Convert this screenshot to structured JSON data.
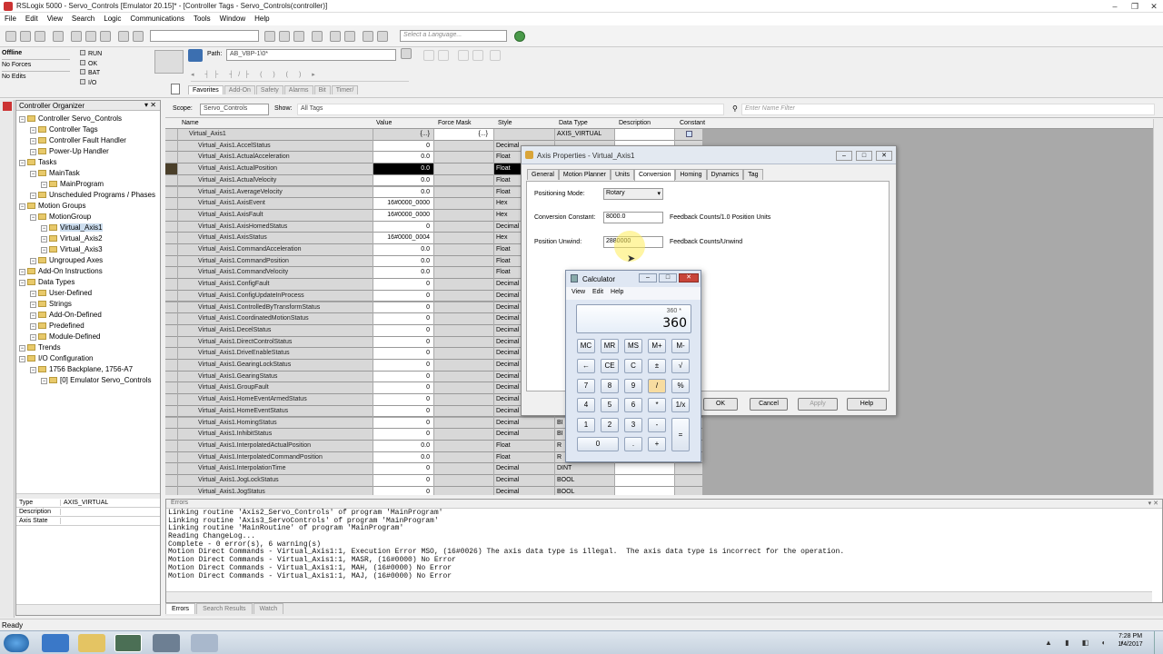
{
  "window": {
    "title": "RSLogix 5000 - Servo_Controls [Emulator 20.15]* - [Controller Tags - Servo_Controls(controller)]"
  },
  "menu": [
    "File",
    "Edit",
    "View",
    "Search",
    "Logic",
    "Communications",
    "Tools",
    "Window",
    "Help"
  ],
  "toolbar": {
    "language_placeholder": "Select a Language..."
  },
  "status": {
    "mode": "Offline",
    "forces": "No Forces",
    "edits": "No Edits",
    "leds": [
      "RUN",
      "OK",
      "BAT",
      "I/O"
    ],
    "path_label": "Path:",
    "path_value": "AB_VBP-1\\0*"
  },
  "instr_tabs": [
    "Favorites",
    "Add-On",
    "Safety",
    "Alarms",
    "Bit",
    "Timer/"
  ],
  "organizer": {
    "title": "Controller Organizer",
    "items": [
      {
        "label": "Controller Servo_Controls",
        "d": 1
      },
      {
        "label": "Controller Tags",
        "d": 2
      },
      {
        "label": "Controller Fault Handler",
        "d": 2
      },
      {
        "label": "Power-Up Handler",
        "d": 2
      },
      {
        "label": "Tasks",
        "d": 1
      },
      {
        "label": "MainTask",
        "d": 2
      },
      {
        "label": "MainProgram",
        "d": 3
      },
      {
        "label": "Unscheduled Programs / Phases",
        "d": 2
      },
      {
        "label": "Motion Groups",
        "d": 1
      },
      {
        "label": "MotionGroup",
        "d": 2
      },
      {
        "label": "Virtual_Axis1",
        "d": 3
      },
      {
        "label": "Virtual_Axis2",
        "d": 3
      },
      {
        "label": "Virtual_Axis3",
        "d": 3
      },
      {
        "label": "Ungrouped Axes",
        "d": 2
      },
      {
        "label": "Add-On Instructions",
        "d": 1
      },
      {
        "label": "Data Types",
        "d": 1
      },
      {
        "label": "User-Defined",
        "d": 2
      },
      {
        "label": "Strings",
        "d": 2
      },
      {
        "label": "Add-On-Defined",
        "d": 2
      },
      {
        "label": "Predefined",
        "d": 2
      },
      {
        "label": "Module-Defined",
        "d": 2
      },
      {
        "label": "Trends",
        "d": 1
      },
      {
        "label": "I/O Configuration",
        "d": 1
      },
      {
        "label": "1756 Backplane, 1756-A7",
        "d": 2
      },
      {
        "label": "[0] Emulator Servo_Controls",
        "d": 3
      }
    ],
    "props": [
      [
        "Type",
        "AXIS_VIRTUAL"
      ],
      [
        "Description",
        ""
      ],
      [
        "Axis State",
        ""
      ]
    ]
  },
  "tags": {
    "scope_label": "Scope:",
    "scope_value": "Servo_Controls",
    "show_label": "Show:",
    "show_value": "All Tags",
    "filter_placeholder": "Enter Name Filter",
    "columns": [
      "Name",
      "Value",
      "Force Mask",
      "Style",
      "Data Type",
      "Description",
      "Constant"
    ],
    "rows": [
      [
        "Virtual_Axis1",
        "{...}",
        "{...}",
        "",
        "AXIS_VIRTUAL"
      ],
      [
        "Virtual_Axis1.AccelStatus",
        "0",
        "",
        "Decimal",
        ""
      ],
      [
        "Virtual_Axis1.ActualAcceleration",
        "0.0",
        "",
        "Float",
        ""
      ],
      [
        "Virtual_Axis1.ActualPosition",
        "0.0",
        "",
        "Float",
        ""
      ],
      [
        "Virtual_Axis1.ActualVelocity",
        "0.0",
        "",
        "Float",
        ""
      ],
      [
        "Virtual_Axis1.AverageVelocity",
        "0.0",
        "",
        "Float",
        ""
      ],
      [
        "Virtual_Axis1.AxisEvent",
        "16#0000_0000",
        "",
        "Hex",
        ""
      ],
      [
        "Virtual_Axis1.AxisFault",
        "16#0000_0000",
        "",
        "Hex",
        ""
      ],
      [
        "Virtual_Axis1.AxisHomedStatus",
        "0",
        "",
        "Decimal",
        ""
      ],
      [
        "Virtual_Axis1.AxisStatus",
        "16#0000_0004",
        "",
        "Hex",
        ""
      ],
      [
        "Virtual_Axis1.CommandAcceleration",
        "0.0",
        "",
        "Float",
        ""
      ],
      [
        "Virtual_Axis1.CommandPosition",
        "0.0",
        "",
        "Float",
        ""
      ],
      [
        "Virtual_Axis1.CommandVelocity",
        "0.0",
        "",
        "Float",
        ""
      ],
      [
        "Virtual_Axis1.ConfigFault",
        "0",
        "",
        "Decimal",
        ""
      ],
      [
        "Virtual_Axis1.ConfigUpdateInProcess",
        "0",
        "",
        "Decimal",
        ""
      ],
      [
        "Virtual_Axis1.ControlledByTransformStatus",
        "0",
        "",
        "Decimal",
        ""
      ],
      [
        "Virtual_Axis1.CoordinatedMotionStatus",
        "0",
        "",
        "Decimal",
        ""
      ],
      [
        "Virtual_Axis1.DecelStatus",
        "0",
        "",
        "Decimal",
        ""
      ],
      [
        "Virtual_Axis1.DirectControlStatus",
        "0",
        "",
        "Decimal",
        ""
      ],
      [
        "Virtual_Axis1.DriveEnableStatus",
        "0",
        "",
        "Decimal",
        ""
      ],
      [
        "Virtual_Axis1.GearingLockStatus",
        "0",
        "",
        "Decimal",
        ""
      ],
      [
        "Virtual_Axis1.GearingStatus",
        "0",
        "",
        "Decimal",
        ""
      ],
      [
        "Virtual_Axis1.GroupFault",
        "0",
        "",
        "Decimal",
        ""
      ],
      [
        "Virtual_Axis1.HomeEventArmedStatus",
        "0",
        "",
        "Decimal",
        ""
      ],
      [
        "Virtual_Axis1.HomeEventStatus",
        "0",
        "",
        "Decimal",
        ""
      ],
      [
        "Virtual_Axis1.HomingStatus",
        "0",
        "",
        "Decimal",
        "BI"
      ],
      [
        "Virtual_Axis1.InhibitStatus",
        "0",
        "",
        "Decimal",
        "BI"
      ],
      [
        "Virtual_Axis1.InterpolatedActualPosition",
        "0.0",
        "",
        "Float",
        "R"
      ],
      [
        "Virtual_Axis1.InterpolatedCommandPosition",
        "0.0",
        "",
        "Float",
        "R"
      ],
      [
        "Virtual_Axis1.InterpolationTime",
        "0",
        "",
        "Decimal",
        "DINT"
      ],
      [
        "Virtual_Axis1.JogLockStatus",
        "0",
        "",
        "Decimal",
        "BOOL"
      ],
      [
        "Virtual_Axis1.JogStatus",
        "0",
        "",
        "Decimal",
        "BOOL"
      ]
    ]
  },
  "axis_dialog": {
    "title": "Axis Properties - Virtual_Axis1",
    "tabs": [
      "General",
      "Motion Planner",
      "Units",
      "Conversion",
      "Homing",
      "Dynamics",
      "Tag"
    ],
    "positioning_mode_label": "Positioning Mode:",
    "positioning_mode_value": "Rotary",
    "conversion_label": "Conversion Constant:",
    "conversion_value": "8000.0",
    "conversion_units": "Feedback Counts/1.0 Position Units",
    "unwind_label": "Position Unwind:",
    "unwind_value": "2880000",
    "unwind_units": "Feedback Counts/Unwind",
    "ok": "OK",
    "cancel": "Cancel",
    "apply": "Apply",
    "help": "Help"
  },
  "calculator": {
    "title": "Calculator",
    "menu": [
      "View",
      "Edit",
      "Help"
    ],
    "expression": "360 *",
    "display": "360",
    "keys": [
      [
        "MC",
        "MR",
        "MS",
        "M+",
        "M-"
      ],
      [
        "←",
        "CE",
        "C",
        "±",
        "√"
      ],
      [
        "7",
        "8",
        "9",
        "/",
        "%"
      ],
      [
        "4",
        "5",
        "6",
        "*",
        "1/x"
      ],
      [
        "1",
        "2",
        "3",
        "-",
        "="
      ],
      [
        "0",
        ".",
        "+"
      ]
    ]
  },
  "errors": {
    "title": "Errors",
    "lines": [
      "Linking routine 'Axis2_Servo_Controls' of program 'MainProgram'",
      "Linking routine 'Axis3_ServoControls' of program 'MainProgram'",
      "Linking routine 'MainRoutine' of program 'MainProgram'",
      "Reading ChangeLog...",
      "Complete - 0 error(s), 6 warning(s)",
      "Motion Direct Commands - Virtual_Axis1:1, Execution Error MSO, (16#0026) The axis data type is illegal.  The axis data type is incorrect for the operation.",
      "Motion Direct Commands - Virtual_Axis1:1, MASR, (16#0000) No Error",
      "Motion Direct Commands - Virtual_Axis1:1, MAH, (16#0000) No Error",
      "Motion Direct Commands - Virtual_Axis1:1, MAJ, (16#0000) No Error"
    ],
    "tabs": [
      "Errors",
      "Search Results",
      "Watch"
    ]
  },
  "statusbar": {
    "text": "Ready"
  },
  "clock": {
    "time": "7:28 PM",
    "date": "1/4/2017"
  }
}
